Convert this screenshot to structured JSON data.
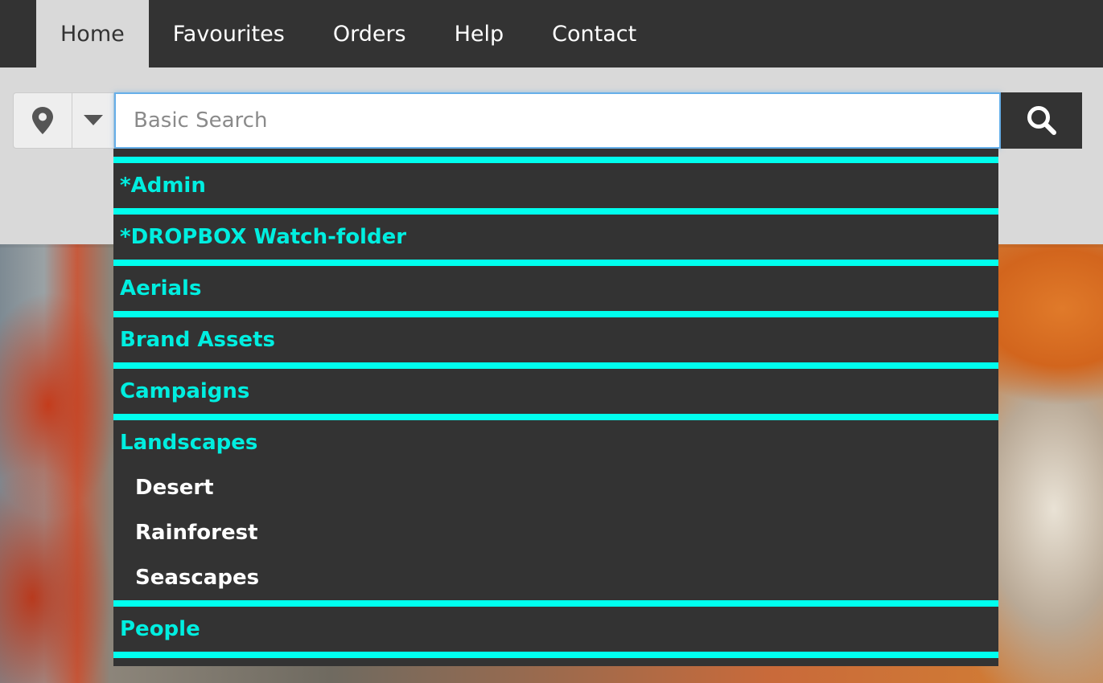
{
  "nav": {
    "items": [
      {
        "label": "Home",
        "active": true
      },
      {
        "label": "Favourites",
        "active": false
      },
      {
        "label": "Orders",
        "active": false
      },
      {
        "label": "Help",
        "active": false
      },
      {
        "label": "Contact",
        "active": false
      }
    ]
  },
  "search": {
    "placeholder": "Basic Search",
    "value": "",
    "location_icon": "map-marker-icon",
    "caret_icon": "caret-down-icon",
    "submit_icon": "search-icon"
  },
  "dropdown": {
    "categories": [
      {
        "label": "*Admin",
        "children": []
      },
      {
        "label": "*DROPBOX Watch-folder",
        "children": []
      },
      {
        "label": "Aerials",
        "children": []
      },
      {
        "label": "Brand Assets",
        "children": []
      },
      {
        "label": "Campaigns",
        "children": []
      },
      {
        "label": "Landscapes",
        "children": [
          "Desert",
          "Rainforest",
          "Seascapes"
        ]
      },
      {
        "label": "People",
        "children": []
      }
    ]
  },
  "colors": {
    "nav_bg": "#333333",
    "accent_cyan": "#00ffee",
    "page_bg": "#d9d9d9",
    "focus_blue": "#66afe9"
  }
}
